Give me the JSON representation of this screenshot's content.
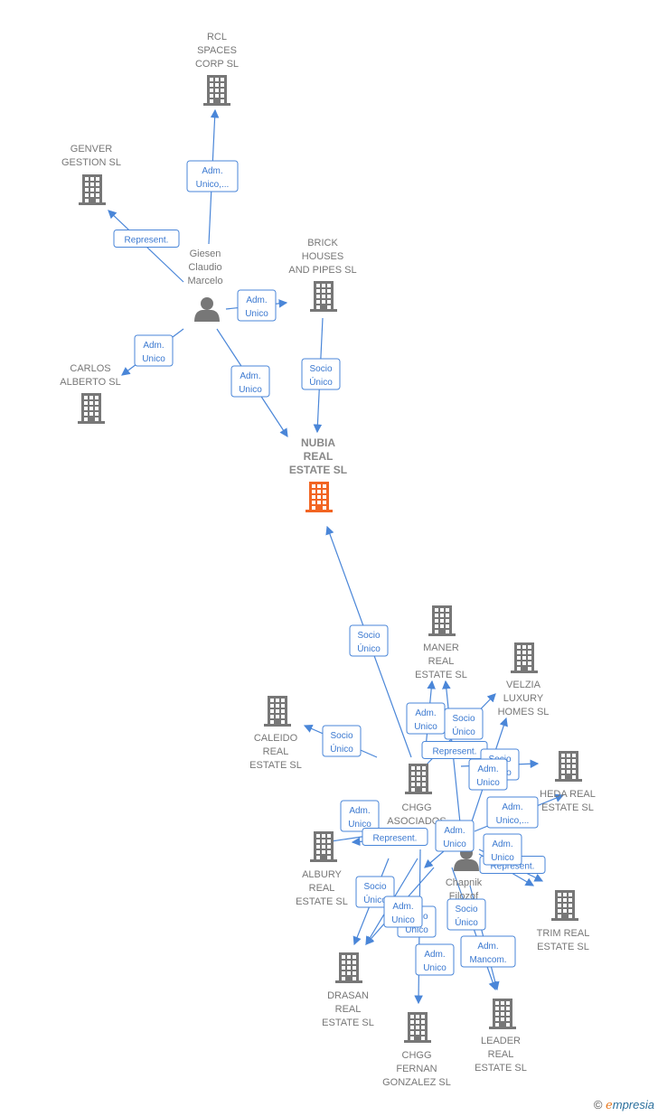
{
  "colors": {
    "edge": "#4a86d8",
    "company": "#777777",
    "focus": "#f26522"
  },
  "nodes": [
    {
      "type": "company",
      "icon": "building-icon",
      "lines": [
        "RCL",
        "SPACES",
        "CORP SL"
      ]
    },
    {
      "type": "company",
      "icon": "building-icon",
      "lines": [
        "GENVER",
        "GESTION SL"
      ]
    },
    {
      "type": "person",
      "icon": "person-icon",
      "lines": [
        "Giesen",
        "Claudio",
        "Marcelo"
      ]
    },
    {
      "type": "company",
      "icon": "building-icon",
      "lines": [
        "BRICK",
        "HOUSES",
        "AND PIPES SL"
      ]
    },
    {
      "type": "company",
      "icon": "building-icon",
      "lines": [
        "CARLOS",
        "ALBERTO SL"
      ]
    },
    {
      "type": "focus",
      "icon": "building-icon",
      "lines": [
        "NUBIA",
        "REAL",
        "ESTATE  SL"
      ]
    },
    {
      "type": "company",
      "icon": "building-icon",
      "lines": [
        "MANER",
        "REAL",
        "ESTATE  SL"
      ]
    },
    {
      "type": "company",
      "icon": "building-icon",
      "lines": [
        "VELZIA",
        "LUXURY",
        "HOMES  SL"
      ]
    },
    {
      "type": "company",
      "icon": "building-icon",
      "lines": [
        "CALEIDO",
        "REAL",
        "ESTATE  SL"
      ]
    },
    {
      "type": "company",
      "icon": "building-icon",
      "lines": [
        "CHGG",
        "ASOCIADOS"
      ]
    },
    {
      "type": "company",
      "icon": "building-icon",
      "lines": [
        "HEDA REAL",
        "ESTATE  SL"
      ]
    },
    {
      "type": "person",
      "icon": "person-icon",
      "lines": [
        "Chapnik",
        "Filozof",
        "H"
      ]
    },
    {
      "type": "company",
      "icon": "building-icon",
      "lines": [
        "ALBURY",
        "REAL",
        "ESTATE  SL"
      ]
    },
    {
      "type": "company",
      "icon": "building-icon",
      "lines": [
        "TRIM REAL",
        "ESTATE  SL"
      ]
    },
    {
      "type": "company",
      "icon": "building-icon",
      "lines": [
        "DRASAN",
        "REAL",
        "ESTATE  SL"
      ]
    },
    {
      "type": "company",
      "icon": "building-icon",
      "lines": [
        "LEADER",
        "REAL",
        "ESTATE  SL"
      ]
    },
    {
      "type": "company",
      "icon": "building-icon",
      "lines": [
        "CHGG",
        "FERNAN",
        "GONZALEZ  SL"
      ]
    }
  ],
  "edges": [
    {
      "from": 2,
      "to": 0,
      "lines": [
        "Adm.",
        "Unico,..."
      ]
    },
    {
      "from": 2,
      "to": 1,
      "lines": [
        "Represent."
      ]
    },
    {
      "from": 2,
      "to": 3,
      "lines": [
        "Adm.",
        "Unico"
      ]
    },
    {
      "from": 2,
      "to": 4,
      "lines": [
        "Adm.",
        "Unico"
      ]
    },
    {
      "from": 2,
      "to": 5,
      "lines": [
        "Adm.",
        "Unico"
      ]
    },
    {
      "from": 3,
      "to": 5,
      "lines": [
        "Socio",
        "Único"
      ]
    },
    {
      "from": 9,
      "to": 5,
      "lines": [
        "Socio",
        "Único"
      ]
    },
    {
      "from": 9,
      "to": 8,
      "lines": [
        "Socio",
        "Único"
      ]
    },
    {
      "from": 9,
      "to": 6,
      "lines": [
        "Adm.",
        "Unico"
      ]
    },
    {
      "from": 11,
      "to": 6,
      "lines": [
        "Socio",
        "Único"
      ]
    },
    {
      "from": 11,
      "to": 7,
      "lines": [
        "Represent."
      ]
    },
    {
      "from": 9,
      "to": 10,
      "lines": [
        "Socio",
        "Único"
      ]
    },
    {
      "from": 11,
      "to": 7,
      "lines": [
        "Adm.",
        "Unico"
      ]
    },
    {
      "from": 11,
      "to": 10,
      "lines": [
        "Adm.",
        "Unico,..."
      ]
    },
    {
      "from": 11,
      "to": 12,
      "lines": [
        "Adm.",
        "Unico"
      ]
    },
    {
      "from": 11,
      "to": 12,
      "lines": [
        "Represent."
      ]
    },
    {
      "from": 11,
      "to": 13,
      "lines": [
        "Represent."
      ]
    },
    {
      "from": 11,
      "to": 13,
      "lines": [
        "Adm.",
        "Unico"
      ]
    },
    {
      "from": 11,
      "to": 9,
      "lines": [
        "Adm.",
        "Unico"
      ]
    },
    {
      "from": 9,
      "to": 14,
      "lines": [
        "Socio",
        "Unico"
      ]
    },
    {
      "from": 9,
      "to": 14,
      "lines": [
        "Socio",
        "Único"
      ]
    },
    {
      "from": 11,
      "to": 14,
      "lines": [
        "Adm.",
        "Unico"
      ]
    },
    {
      "from": 11,
      "to": 16,
      "lines": [
        "Adm.",
        "Unico"
      ]
    },
    {
      "from": 9,
      "to": 15,
      "lines": [
        "Socio",
        "Único"
      ]
    },
    {
      "from": 11,
      "to": 15,
      "lines": [
        "Adm.",
        "Mancom."
      ]
    }
  ],
  "footer": {
    "copyright": "©",
    "brand_initial": "e",
    "brand_rest": "mpresia"
  }
}
